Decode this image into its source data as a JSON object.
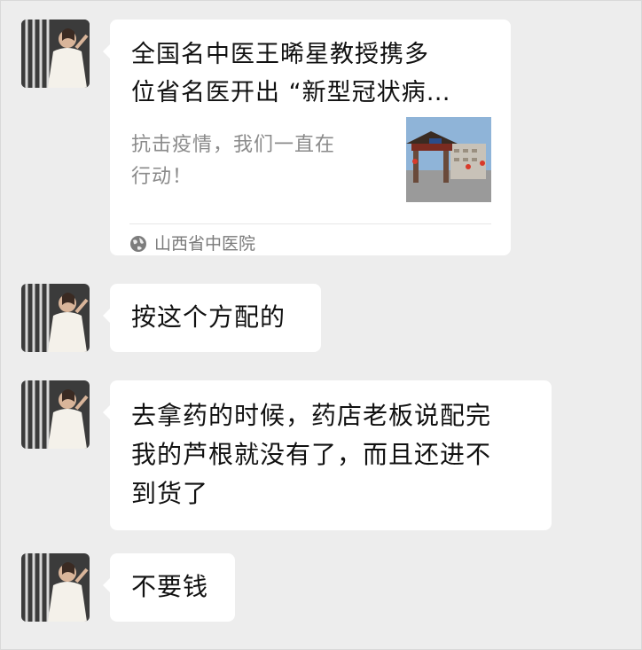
{
  "messages": [
    {
      "type": "link",
      "title_line1": "全国名中医王晞星教授携多",
      "title_line2": "位省名医开出 “新型冠状病…",
      "desc_line1": "抗击疫情，我们一直在",
      "desc_line2": "行动！",
      "source": "山西省中医院",
      "source_icon": "globe-icon",
      "thumb": "hospital-gate-photo"
    },
    {
      "type": "text",
      "lines": [
        "按这个方配的"
      ]
    },
    {
      "type": "text",
      "lines": [
        "去拿药的时候，药店老板说配完",
        "我的芦根就没有了，而且还进不",
        "到货了"
      ]
    },
    {
      "type": "text",
      "lines": [
        "不要钱"
      ]
    }
  ],
  "colors": {
    "background": "#ededed",
    "bubble": "#ffffff",
    "text": "#111111",
    "secondary_text": "#8a8a8a"
  }
}
